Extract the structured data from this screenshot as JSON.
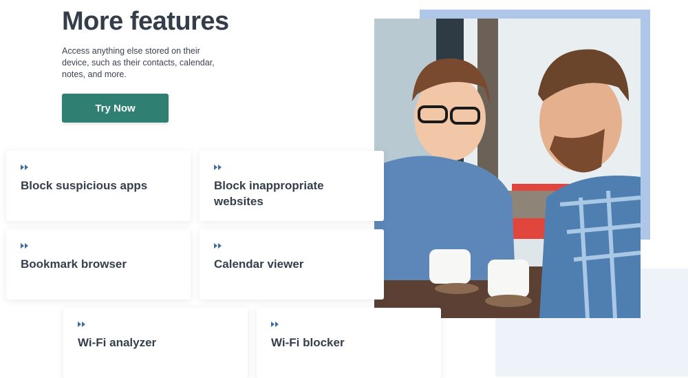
{
  "hero": {
    "title": "More features",
    "description": "Access anything else stored on their device, such as their contacts, calendar, notes, and more.",
    "cta_label": "Try Now"
  },
  "features": [
    {
      "label": "Block suspicious apps",
      "icon": "double-chevron-right-icon"
    },
    {
      "label": "Block inappropriate websites",
      "icon": "double-chevron-right-icon"
    },
    {
      "label": "Bookmark browser",
      "icon": "double-chevron-right-icon"
    },
    {
      "label": "Calendar viewer",
      "icon": "double-chevron-right-icon"
    },
    {
      "label": "Wi-Fi analyzer",
      "icon": "double-chevron-right-icon"
    },
    {
      "label": "Wi-Fi blocker",
      "icon": "double-chevron-right-icon"
    }
  ],
  "colors": {
    "cta_background": "#2f7f72",
    "accent_panel": "#aec7e8",
    "light_panel": "#eef3f9",
    "icon": "#3f6d9e",
    "heading": "#343d4a"
  }
}
